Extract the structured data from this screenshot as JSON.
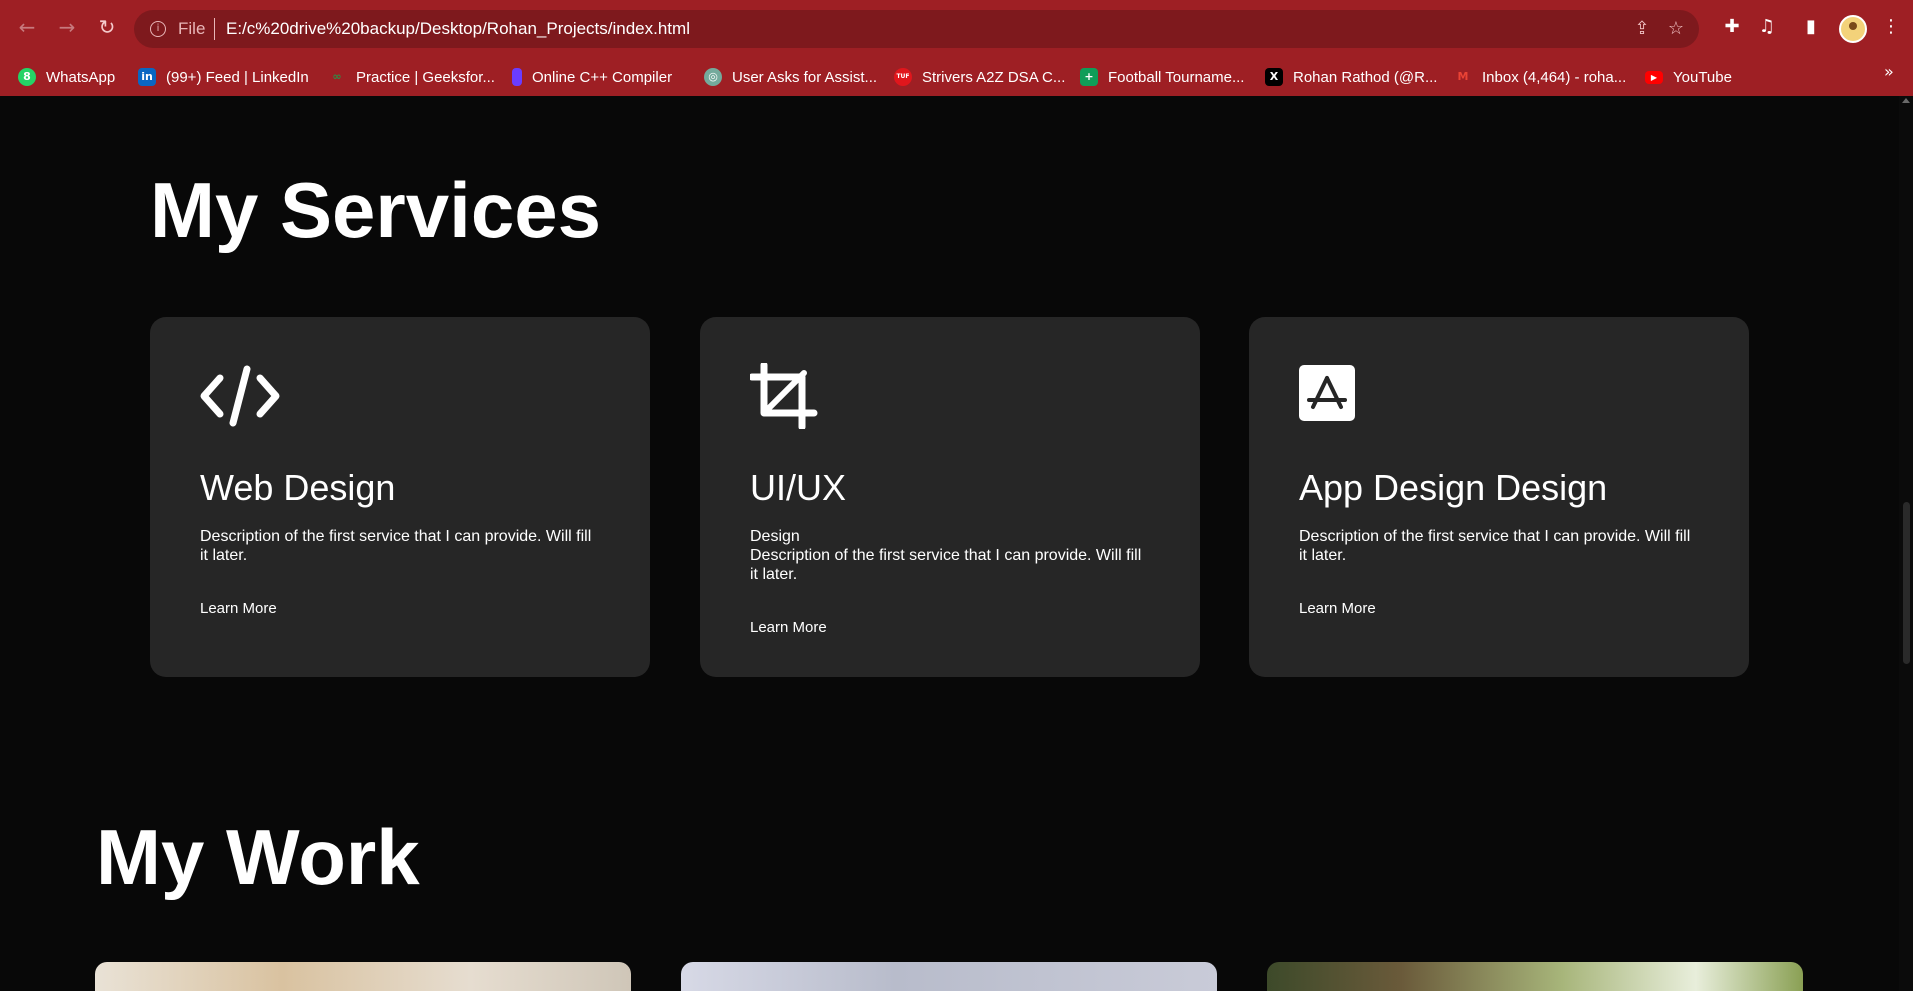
{
  "browser": {
    "scheme_label": "File",
    "url": "E:/c%20drive%20backup/Desktop/Rohan_Projects/index.html",
    "bookmarks": [
      {
        "label": "WhatsApp",
        "icon": "whatsapp-icon",
        "color": "#25d366"
      },
      {
        "label": "(99+) Feed | LinkedIn",
        "icon": "linkedin-icon",
        "color": "#0a66c2"
      },
      {
        "label": "Practice | Geeksfor...",
        "icon": "geeksforgeeks-icon",
        "color": "#2f8d46"
      },
      {
        "label": "Online C++ Compiler",
        "icon": "compiler-icon",
        "color": "#6a3cff"
      },
      {
        "label": "User Asks for Assist...",
        "icon": "chatgpt-icon",
        "color": "#74aa9c"
      },
      {
        "label": "Strivers A2Z DSA C...",
        "icon": "tuf-icon",
        "color": "#e0161c"
      },
      {
        "label": "Football Tourname...",
        "icon": "sheets-icon",
        "color": "#0f9d58"
      },
      {
        "label": "Rohan Rathod (@R...",
        "icon": "x-icon",
        "color": "#000000"
      },
      {
        "label": "Inbox (4,464) - roha...",
        "icon": "gmail-icon",
        "color": "#ea4335"
      },
      {
        "label": "YouTube",
        "icon": "youtube-icon",
        "color": "#ff0000"
      }
    ]
  },
  "services": {
    "title": "My Services",
    "items": [
      {
        "icon": "code-icon",
        "title": "Web Design",
        "lines": [
          "Description of the first service that I can provide. Will fill",
          "it later."
        ],
        "link": "Learn More"
      },
      {
        "icon": "crop-icon",
        "title": "UI/UX",
        "lines": [
          "Design",
          "Description of the first service that I can provide. Will fill",
          "it later."
        ],
        "link": "Learn More"
      },
      {
        "icon": "app-store-icon",
        "title": "App Design Design",
        "lines": [
          "Description of the first service that I can provide. Will fill",
          "it later."
        ],
        "link": "Learn More"
      }
    ]
  },
  "work": {
    "title": "My Work"
  },
  "colors": {
    "chrome_red": "#9e1f24",
    "page_bg": "#080808",
    "card_bg": "#262626"
  }
}
